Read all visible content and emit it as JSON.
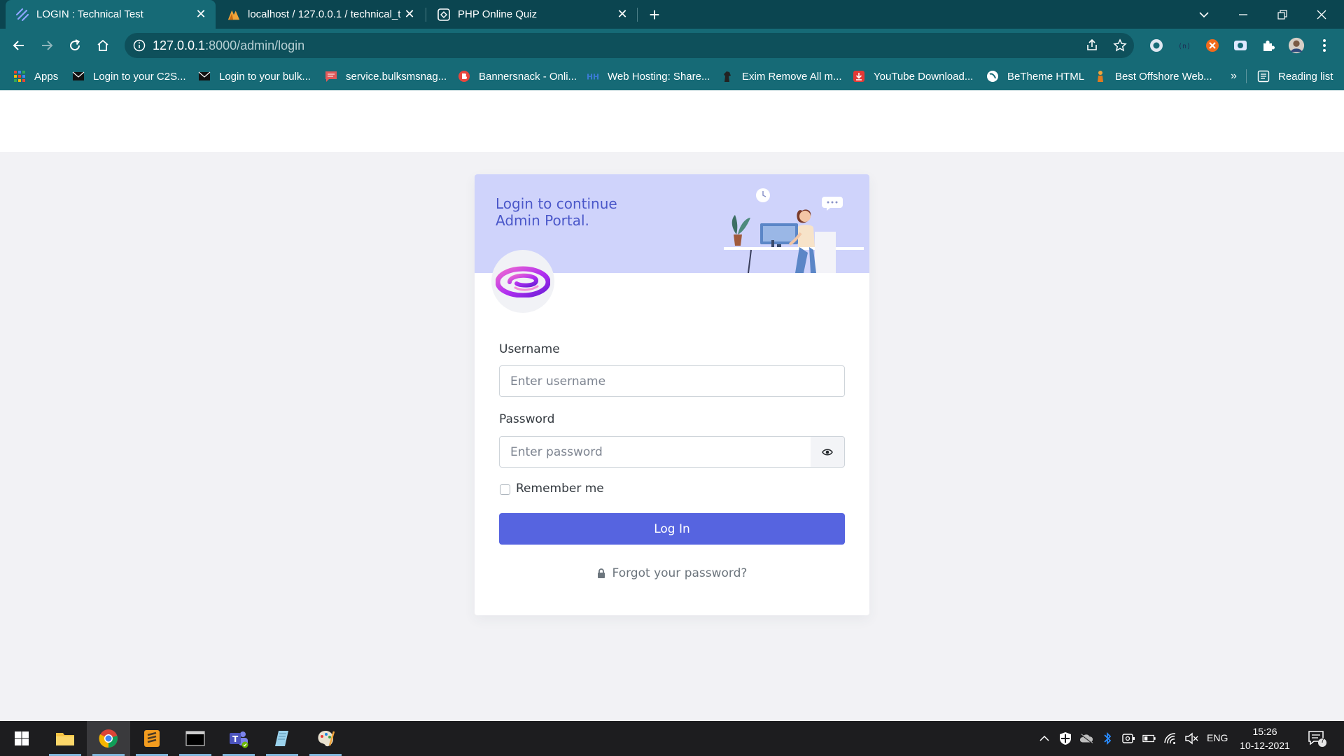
{
  "browser": {
    "tabs": [
      {
        "title": "LOGIN : Technical Test",
        "active": true
      },
      {
        "title": "localhost / 127.0.0.1 / technical_t",
        "active": false
      },
      {
        "title": "PHP Online Quiz",
        "active": false
      }
    ],
    "address": {
      "host": "127.0.0.1",
      "path": ":8000/admin/login"
    },
    "bookmarks": [
      "Apps",
      "Login to your C2S...",
      "Login to your bulk...",
      "service.bulksmsnag...",
      "Bannersnack - Onli...",
      "Web Hosting: Share...",
      "Exim Remove All m...",
      "YouTube Download...",
      "BeTheme HTML",
      "Best Offshore Web..."
    ],
    "overflow_label": "»",
    "reading_list": "Reading list"
  },
  "card": {
    "heading_line1": "Login to continue",
    "heading_line2": "Admin Portal.",
    "username_label": "Username",
    "username_placeholder": "Enter username",
    "password_label": "Password",
    "password_placeholder": "Enter password",
    "remember_label": "Remember me",
    "login_button": "Log In",
    "forgot_link": "Forgot your password?"
  },
  "taskbar": {
    "lang": "ENG",
    "time": "15:26",
    "date": "10-12-2021",
    "notification_count": "7"
  },
  "colors": {
    "chrome_dark": "#0b4550",
    "chrome": "#166a76",
    "accent": "#5664e0",
    "header_bg": "#cfd3fb",
    "heading_text": "#4a57c9"
  }
}
